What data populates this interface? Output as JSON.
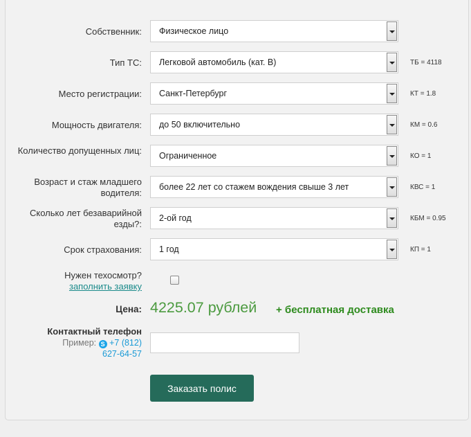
{
  "form": {
    "rows": [
      {
        "label": "Собственник:",
        "value": "Физическое лицо",
        "coef": ""
      },
      {
        "label": "Тип ТС:",
        "value": "Легковой автомобиль (кат. В)",
        "coef": "ТБ = 4118"
      },
      {
        "label": "Место регистрации:",
        "value": "Санкт-Петербург",
        "coef": "КТ = 1.8"
      },
      {
        "label": "Мощность двигателя:",
        "value": "до 50 включительно",
        "coef": "КМ = 0.6"
      },
      {
        "label": "Количество допущенных лиц:",
        "value": "Ограниченное",
        "coef": "КО = 1"
      },
      {
        "label": "Возраст и стаж младшего водителя:",
        "value": "более 22 лет со стажем вождения свыше 3 лет",
        "coef": "КВС = 1"
      },
      {
        "label": "Сколько лет безаварийной езды?:",
        "value": "2-ой год",
        "coef": "КБМ = 0.95"
      },
      {
        "label": "Срок страхования:",
        "value": "1 год",
        "coef": "КП = 1"
      }
    ],
    "inspection": {
      "label": "Нужен техосмотр?",
      "link": "заполнить заявку",
      "checked": false
    },
    "price": {
      "label": "Цена:",
      "value": "4225.07 рублей",
      "delivery": "+ бесплатная доставка"
    },
    "phone": {
      "label": "Контактный телефон",
      "example_prefix": "Пример:",
      "example_number_line1": "+7 (812)",
      "example_number_line2": "627-64-57",
      "value": ""
    },
    "submit_label": "Заказать полис"
  }
}
